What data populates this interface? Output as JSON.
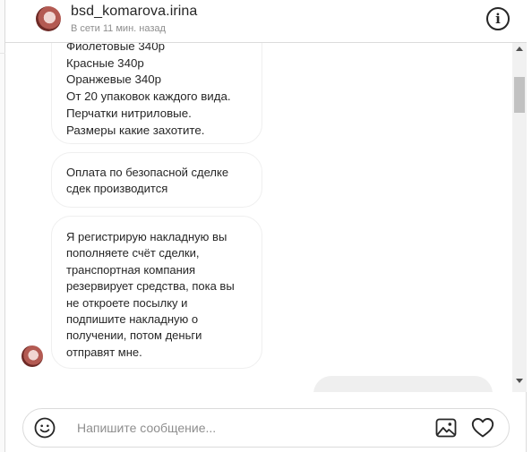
{
  "header": {
    "username": "bsd_komarova.irina",
    "status": "В сети 11 мин. назад",
    "info_symbol": "i"
  },
  "messages": [
    {
      "sender": "incoming",
      "lines": [
        "Фиолетовые 340р",
        "Красные 340р",
        "Оранжевые 340р",
        "От 20 упаковок каждого вида.",
        "Перчатки нитриловые.",
        "Размеры какие захотите."
      ]
    },
    {
      "sender": "incoming",
      "lines": [
        "Оплата по безопасной сделке",
        "сдек производится"
      ]
    },
    {
      "sender": "incoming",
      "lines": [
        "Я регистрирую накладную вы",
        "пополняете счёт сделки,",
        "транспортная компания",
        "резервирует средства, пока вы",
        "не откроете посылку и",
        "подпишите накладную о",
        "получении, потом деньги",
        "отправят мне."
      ]
    }
  ],
  "composer": {
    "placeholder": "Напишите сообщение...",
    "icons": [
      "emoji-icon",
      "image-icon",
      "heart-icon"
    ]
  },
  "colors": {
    "text": "#262626",
    "muted": "#8e8e8e",
    "border": "#dbdbdb",
    "outgoing_bubble": "#efefef"
  }
}
